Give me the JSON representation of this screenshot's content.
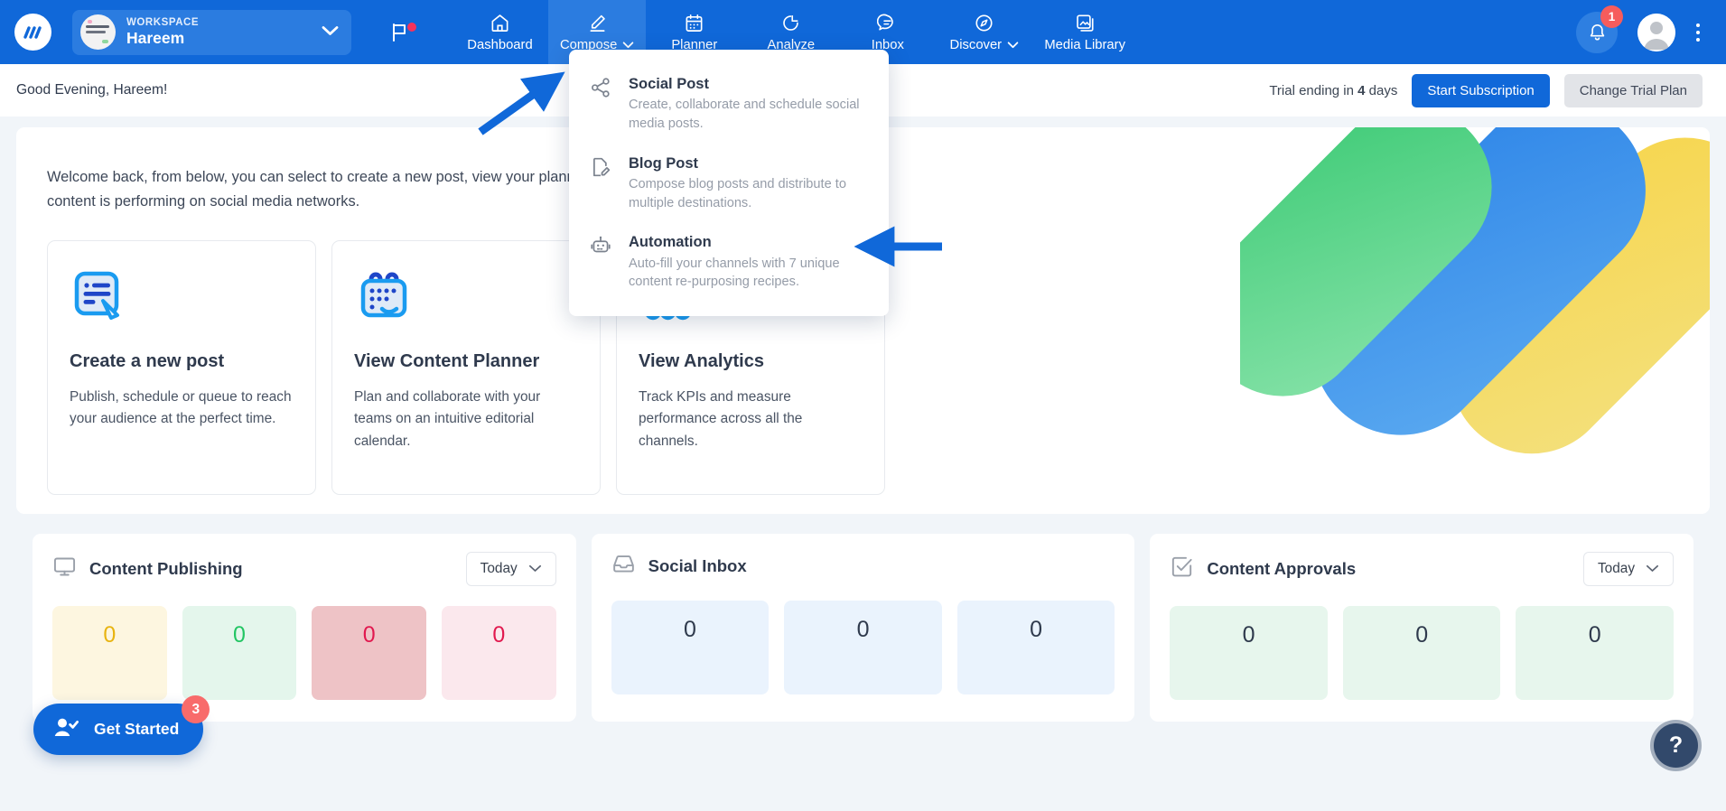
{
  "topnav": {
    "logo_icon": "convosight-logo-icon",
    "workspace": {
      "label": "WORKSPACE",
      "name": "Hareem",
      "chevron_icon": "chevron-down-icon",
      "avatar_icon": "workspace-avatar"
    },
    "flag_icon": "flag-icon",
    "items": [
      {
        "label": "Dashboard",
        "icon": "home-icon",
        "active": false,
        "caret": false
      },
      {
        "label": "Compose",
        "icon": "pencil-icon",
        "active": true,
        "caret": true
      },
      {
        "label": "Planner",
        "icon": "calendar-icon",
        "active": false,
        "caret": false
      },
      {
        "label": "Analyze",
        "icon": "pie-chart-icon",
        "active": false,
        "caret": false
      },
      {
        "label": "Inbox",
        "icon": "chat-icon",
        "active": false,
        "caret": false
      },
      {
        "label": "Discover",
        "icon": "compass-icon",
        "active": false,
        "caret": true
      },
      {
        "label": "Media Library",
        "icon": "image-stack-icon",
        "active": false,
        "caret": false
      }
    ],
    "notifications": {
      "icon": "bell-icon",
      "count": "1"
    },
    "profile_icon": "user-avatar-icon",
    "kebab_icon": "more-vertical-icon"
  },
  "compose_menu": {
    "items": [
      {
        "icon": "share-nodes-icon",
        "title": "Social Post",
        "description": "Create, collaborate and schedule social media posts."
      },
      {
        "icon": "document-edit-icon",
        "title": "Blog Post",
        "description": "Compose blog posts and distribute to multiple destinations."
      },
      {
        "icon": "robot-icon",
        "title": "Automation",
        "description": "Auto-fill your channels with 7 unique content re-purposing recipes."
      }
    ]
  },
  "subheader": {
    "greeting": "Good Evening, Hareem!",
    "trial_prefix": "Trial ending in ",
    "trial_days": "4",
    "trial_suffix": " days",
    "start_subscription_label": "Start Subscription",
    "change_trial_label": "Change Trial Plan"
  },
  "hero": {
    "intro": "Welcome back, from below, you can select to create a new post, view your planned content and measure how your content is performing on social media networks.",
    "cards": [
      {
        "icon": "new-post-icon",
        "title": "Create a new post",
        "description": "Publish, schedule or queue to reach your audience at the perfect time."
      },
      {
        "icon": "content-calendar-icon",
        "title": "View Content Planner",
        "description": "Plan and collaborate with your teams on an intuitive editorial calendar."
      },
      {
        "icon": "analytics-chart-icon",
        "title": "View Analytics",
        "description": "Track KPIs and measure performance across all the channels."
      }
    ]
  },
  "panels": [
    {
      "icon": "monitor-icon",
      "title": "Content Publishing",
      "filter_label": "Today",
      "filter_caret_icon": "chevron-down-icon",
      "stats": [
        {
          "value": "0",
          "bg": "#fdf6e0",
          "color": "#e8b411"
        },
        {
          "value": "0",
          "bg": "#e4f6ec",
          "color": "#22c563"
        },
        {
          "value": "0",
          "bg": "#eec3c6",
          "color": "#e1194f"
        },
        {
          "value": "0",
          "bg": "#fbe8ed",
          "color": "#e1194f"
        }
      ]
    },
    {
      "icon": "inbox-tray-icon",
      "title": "Social Inbox",
      "filter_label": "",
      "filter_caret_icon": "",
      "stats": [
        {
          "value": "0",
          "bg": "#eaf3fd",
          "color": "#2f3a4d"
        },
        {
          "value": "0",
          "bg": "#eaf3fd",
          "color": "#2f3a4d"
        },
        {
          "value": "0",
          "bg": "#eaf3fd",
          "color": "#2f3a4d"
        }
      ]
    },
    {
      "icon": "checkbox-check-icon",
      "title": "Content Approvals",
      "filter_label": "Today",
      "filter_caret_icon": "chevron-down-icon",
      "stats": [
        {
          "value": "0",
          "bg": "#e7f6ed",
          "color": "#2f3a4d"
        },
        {
          "value": "0",
          "bg": "#e7f6ed",
          "color": "#2f3a4d"
        },
        {
          "value": "0",
          "bg": "#e7f6ed",
          "color": "#2f3a4d"
        }
      ]
    }
  ],
  "floating": {
    "get_started": {
      "label": "Get Started",
      "icon": "user-check-icon",
      "badge": "3"
    },
    "help": {
      "label": "?",
      "icon": "question-mark-icon"
    }
  },
  "colors": {
    "nav_blue": "#1068d9",
    "nav_active": "#2b7ce0",
    "accent": "#1068d9",
    "badge_red": "#f6325c",
    "arrow_blue": "#1068d9",
    "art_yellow": "#f6d550",
    "art_green": "#4ad07f",
    "art_blue": "#2f86e8"
  }
}
